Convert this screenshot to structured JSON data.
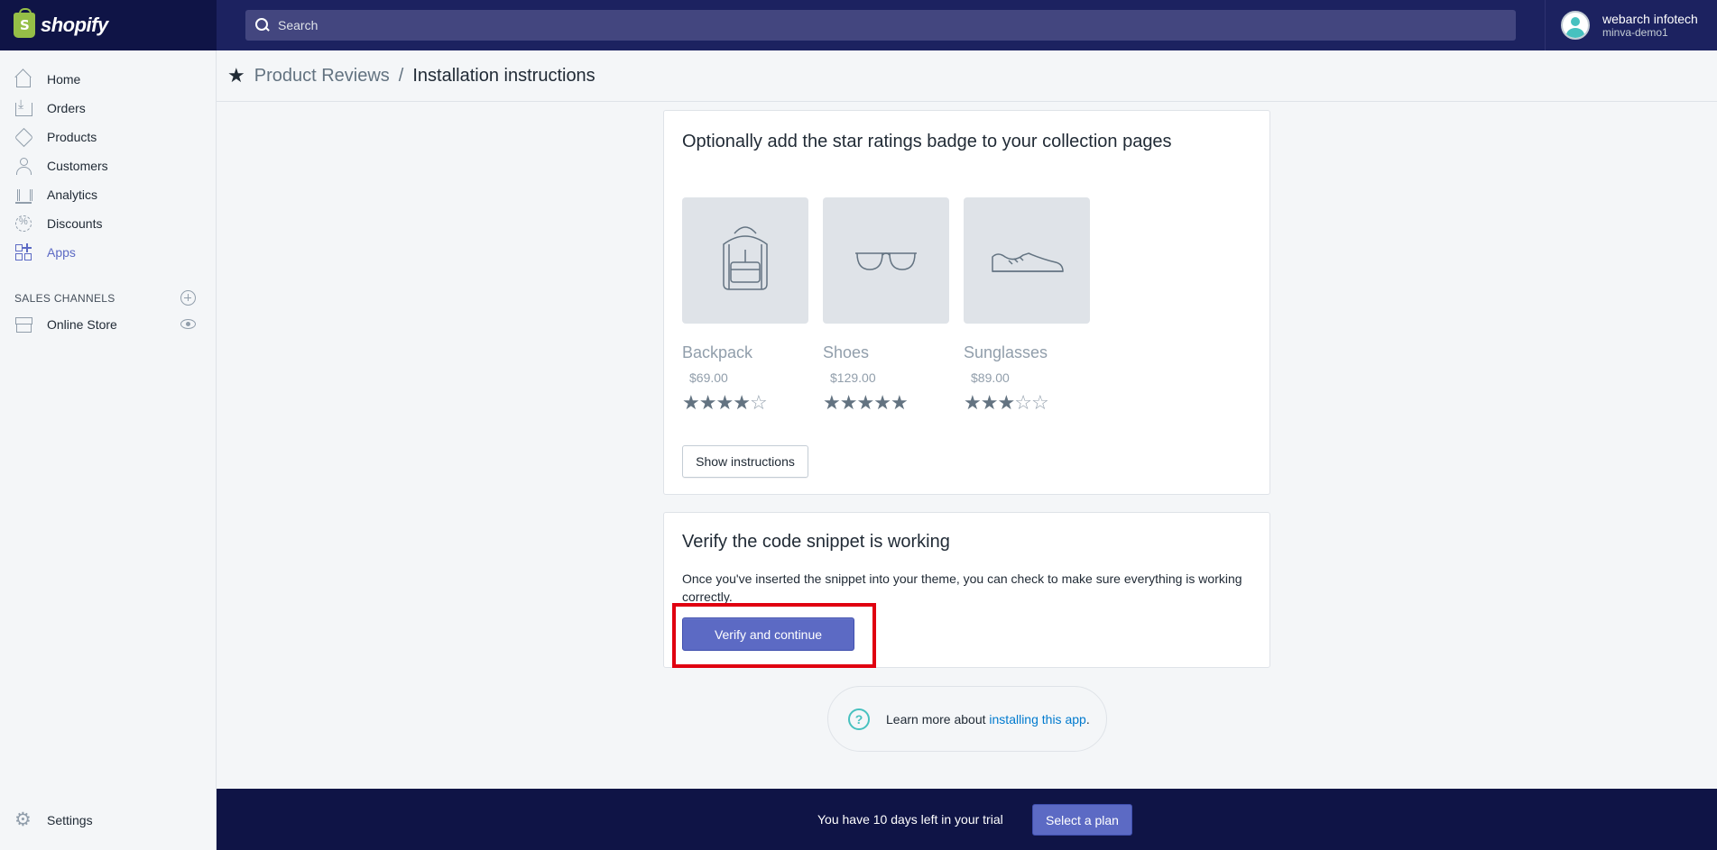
{
  "header": {
    "logo_text": "shopify",
    "logo_mark": "S",
    "search_placeholder": "Search",
    "account_name": "webarch infotech",
    "account_store": "minva-demo1"
  },
  "sidebar": {
    "items": [
      {
        "label": "Home",
        "icon": "home-icon"
      },
      {
        "label": "Orders",
        "icon": "orders-icon"
      },
      {
        "label": "Products",
        "icon": "tag-icon"
      },
      {
        "label": "Customers",
        "icon": "person-icon"
      },
      {
        "label": "Analytics",
        "icon": "bar-chart-icon"
      },
      {
        "label": "Discounts",
        "icon": "discount-icon"
      },
      {
        "label": "Apps",
        "icon": "apps-icon",
        "active": true
      }
    ],
    "sales_channels_heading": "SALES CHANNELS",
    "online_store_label": "Online Store",
    "settings_label": "Settings"
  },
  "breadcrumb": {
    "parent": "Product Reviews",
    "separator": "/",
    "current": "Installation instructions"
  },
  "badge_card": {
    "title": "Optionally add the star ratings badge to your collection pages",
    "products": [
      {
        "name": "Backpack",
        "price": "$69.00",
        "rating": 4,
        "max": 5
      },
      {
        "name": "Shoes",
        "price": "$129.00",
        "rating": 5,
        "max": 5
      },
      {
        "name": "Sunglasses",
        "price": "$89.00",
        "rating": 3,
        "max": 5
      }
    ],
    "show_instructions_label": "Show instructions"
  },
  "verify_card": {
    "title": "Verify the code snippet is working",
    "description": "Once you've inserted the snippet into your theme, you can check to make sure everything is working correctly.",
    "verify_button_label": "Verify and continue"
  },
  "help": {
    "prefix": "Learn more about ",
    "link_text": "installing this app",
    "suffix": "."
  },
  "trial_banner": {
    "text": "You have 10 days left in your trial",
    "button_label": "Select a plan"
  },
  "colors": {
    "accent": "#5c6ac4",
    "topbar": "#1c2260",
    "highlight": "#e00010"
  }
}
